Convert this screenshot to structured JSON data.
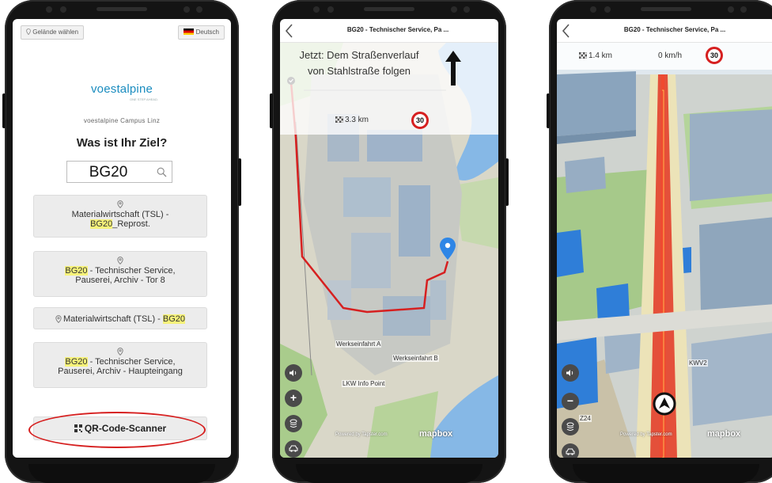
{
  "phone1": {
    "site_button": "Gelände wählen",
    "language_button": "Deutsch",
    "logo": "voestalpine",
    "tagline": "ONE STEP AHEAD.",
    "campus": "voestalpine Campus Linz",
    "question": "Was ist Ihr Ziel?",
    "search_value": "BG20",
    "results": [
      {
        "before": "Materialwirtschaft (TSL) -",
        "highlight": "BG20",
        "after": "_Reprost."
      },
      {
        "highlight": "BG20",
        "after": " - Technischer Service,",
        "line2": "Pauserei, Archiv - Tor 8"
      },
      {
        "before": "Materialwirtschaft (TSL) - ",
        "highlight": "BG20"
      },
      {
        "highlight": "BG20",
        "after": " - Technischer Service,",
        "line2": "Pauserei, Archiv - Haupteingang"
      }
    ],
    "qr_button": "QR-Code-Scanner"
  },
  "phone2": {
    "title": "BG20 - Technischer Service, Pa ...",
    "instruction": "Jetzt: Dem Straßenverlauf von Stahlstraße folgen",
    "distance": "3.3 km",
    "speed_limit": "30",
    "labels": {
      "gate_a": "Werkseinfahrt A",
      "gate_b": "Werkseinfahrt B",
      "truck_info": "LKW Info Point"
    },
    "attribution": "Powered by Tapster.com",
    "mapbox": "mapbox"
  },
  "phone3": {
    "title": "BG20 - Technischer Service, Pa ...",
    "distance": "1.4 km",
    "speed": "0 km/h",
    "speed_limit": "30",
    "labels": {
      "kw": "KWV2",
      "z24": "Z24"
    },
    "attribution": "Powered by Tapster.com",
    "mapbox": "mapbox"
  },
  "colors": {
    "brand": "#1a8cbf",
    "highlight": "#f6f27a",
    "route": "#d62020"
  }
}
